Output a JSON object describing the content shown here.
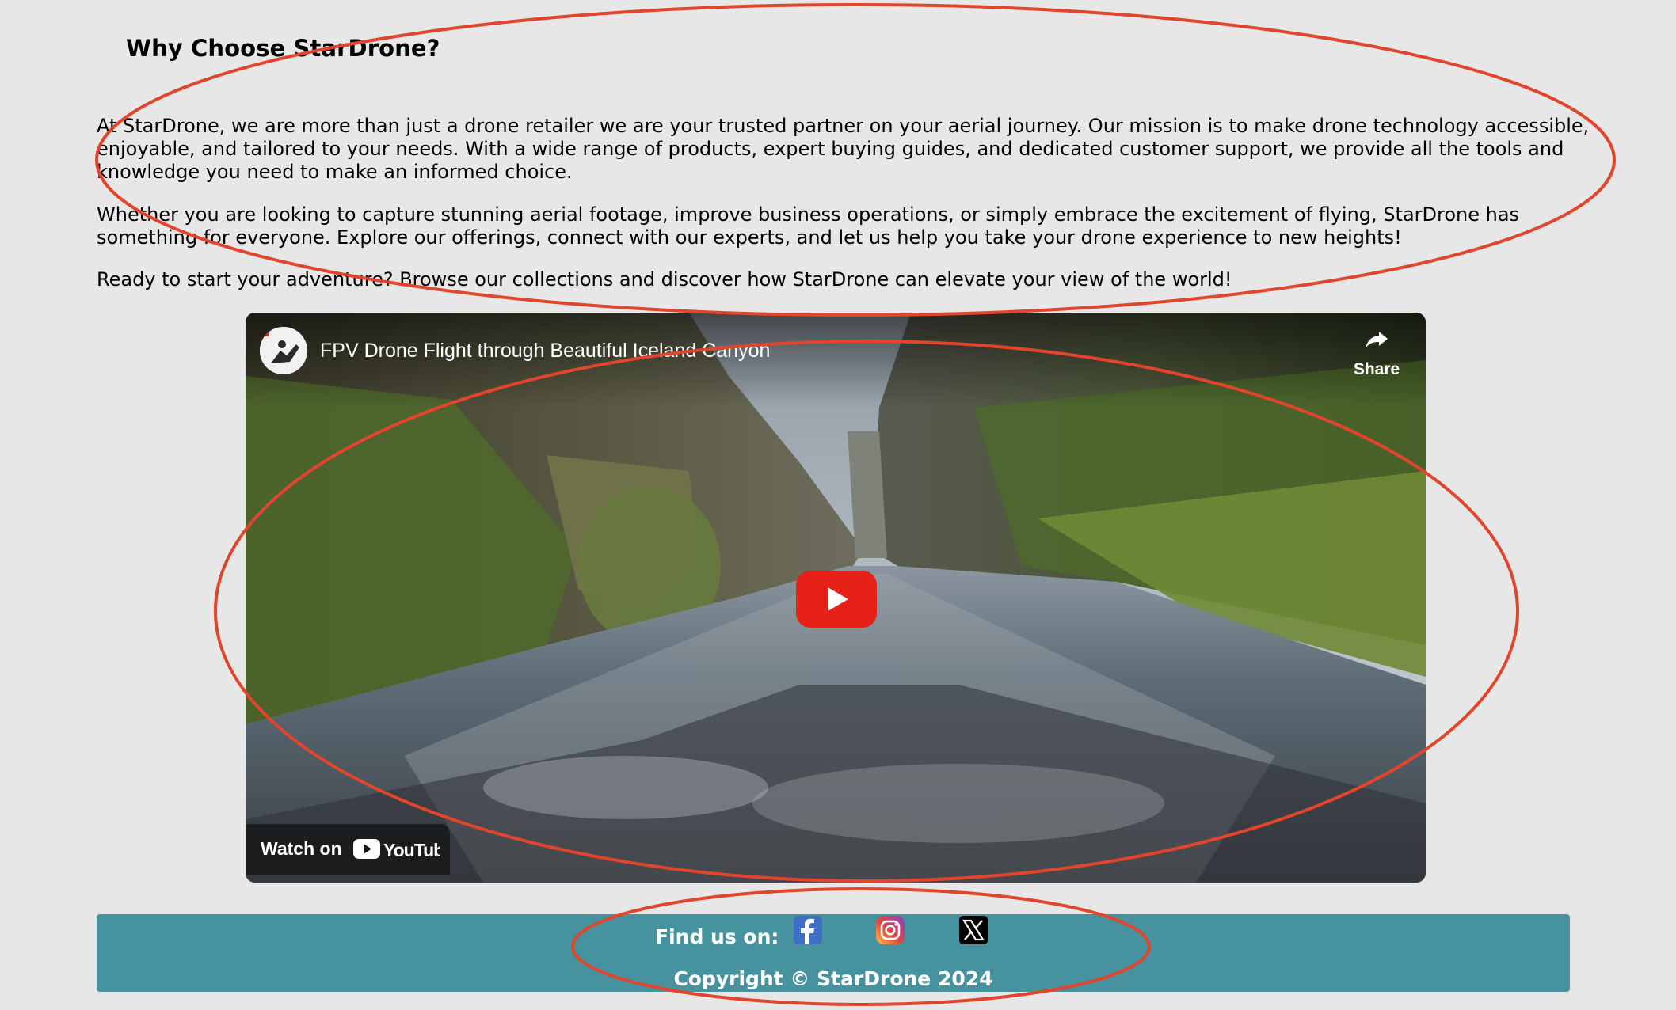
{
  "about": {
    "heading": "Why Choose StarDrone?",
    "paragraph_1": "At StarDrone, we are more than just a drone retailer we are your trusted partner on your aerial journey. Our mission is to make drone technology accessible, enjoyable, and tailored to your needs. With a wide range of products, expert buying guides, and dedicated customer support, we provide all the tools and knowledge you need to make an informed choice.",
    "paragraph_2": "Whether you are looking to capture stunning aerial footage, improve business operations, or simply embrace the excitement of flying, StarDrone has something for everyone. Explore our offerings, connect with our experts, and let us help you take your drone experience to new heights!",
    "paragraph_3": "Ready to start your adventure? Browse our collections and discover how StarDrone can elevate your view of the world!"
  },
  "video": {
    "title": "FPV Drone Flight through Beautiful Iceland Canyon",
    "share_label": "Share",
    "watch_on_label": "Watch on",
    "platform_logo": "YouTube",
    "play_icon": "play-icon"
  },
  "footer": {
    "find_label": "Find us on:",
    "social_icons": [
      "facebook-icon",
      "instagram-icon",
      "x-icon"
    ],
    "copyright": "Copyright © StarDrone 2024"
  },
  "colors": {
    "page_background": "#e7e7e7",
    "footer_background": "#46939f",
    "annotation_stroke": "#e2452c",
    "youtube_red": "#e62117"
  }
}
